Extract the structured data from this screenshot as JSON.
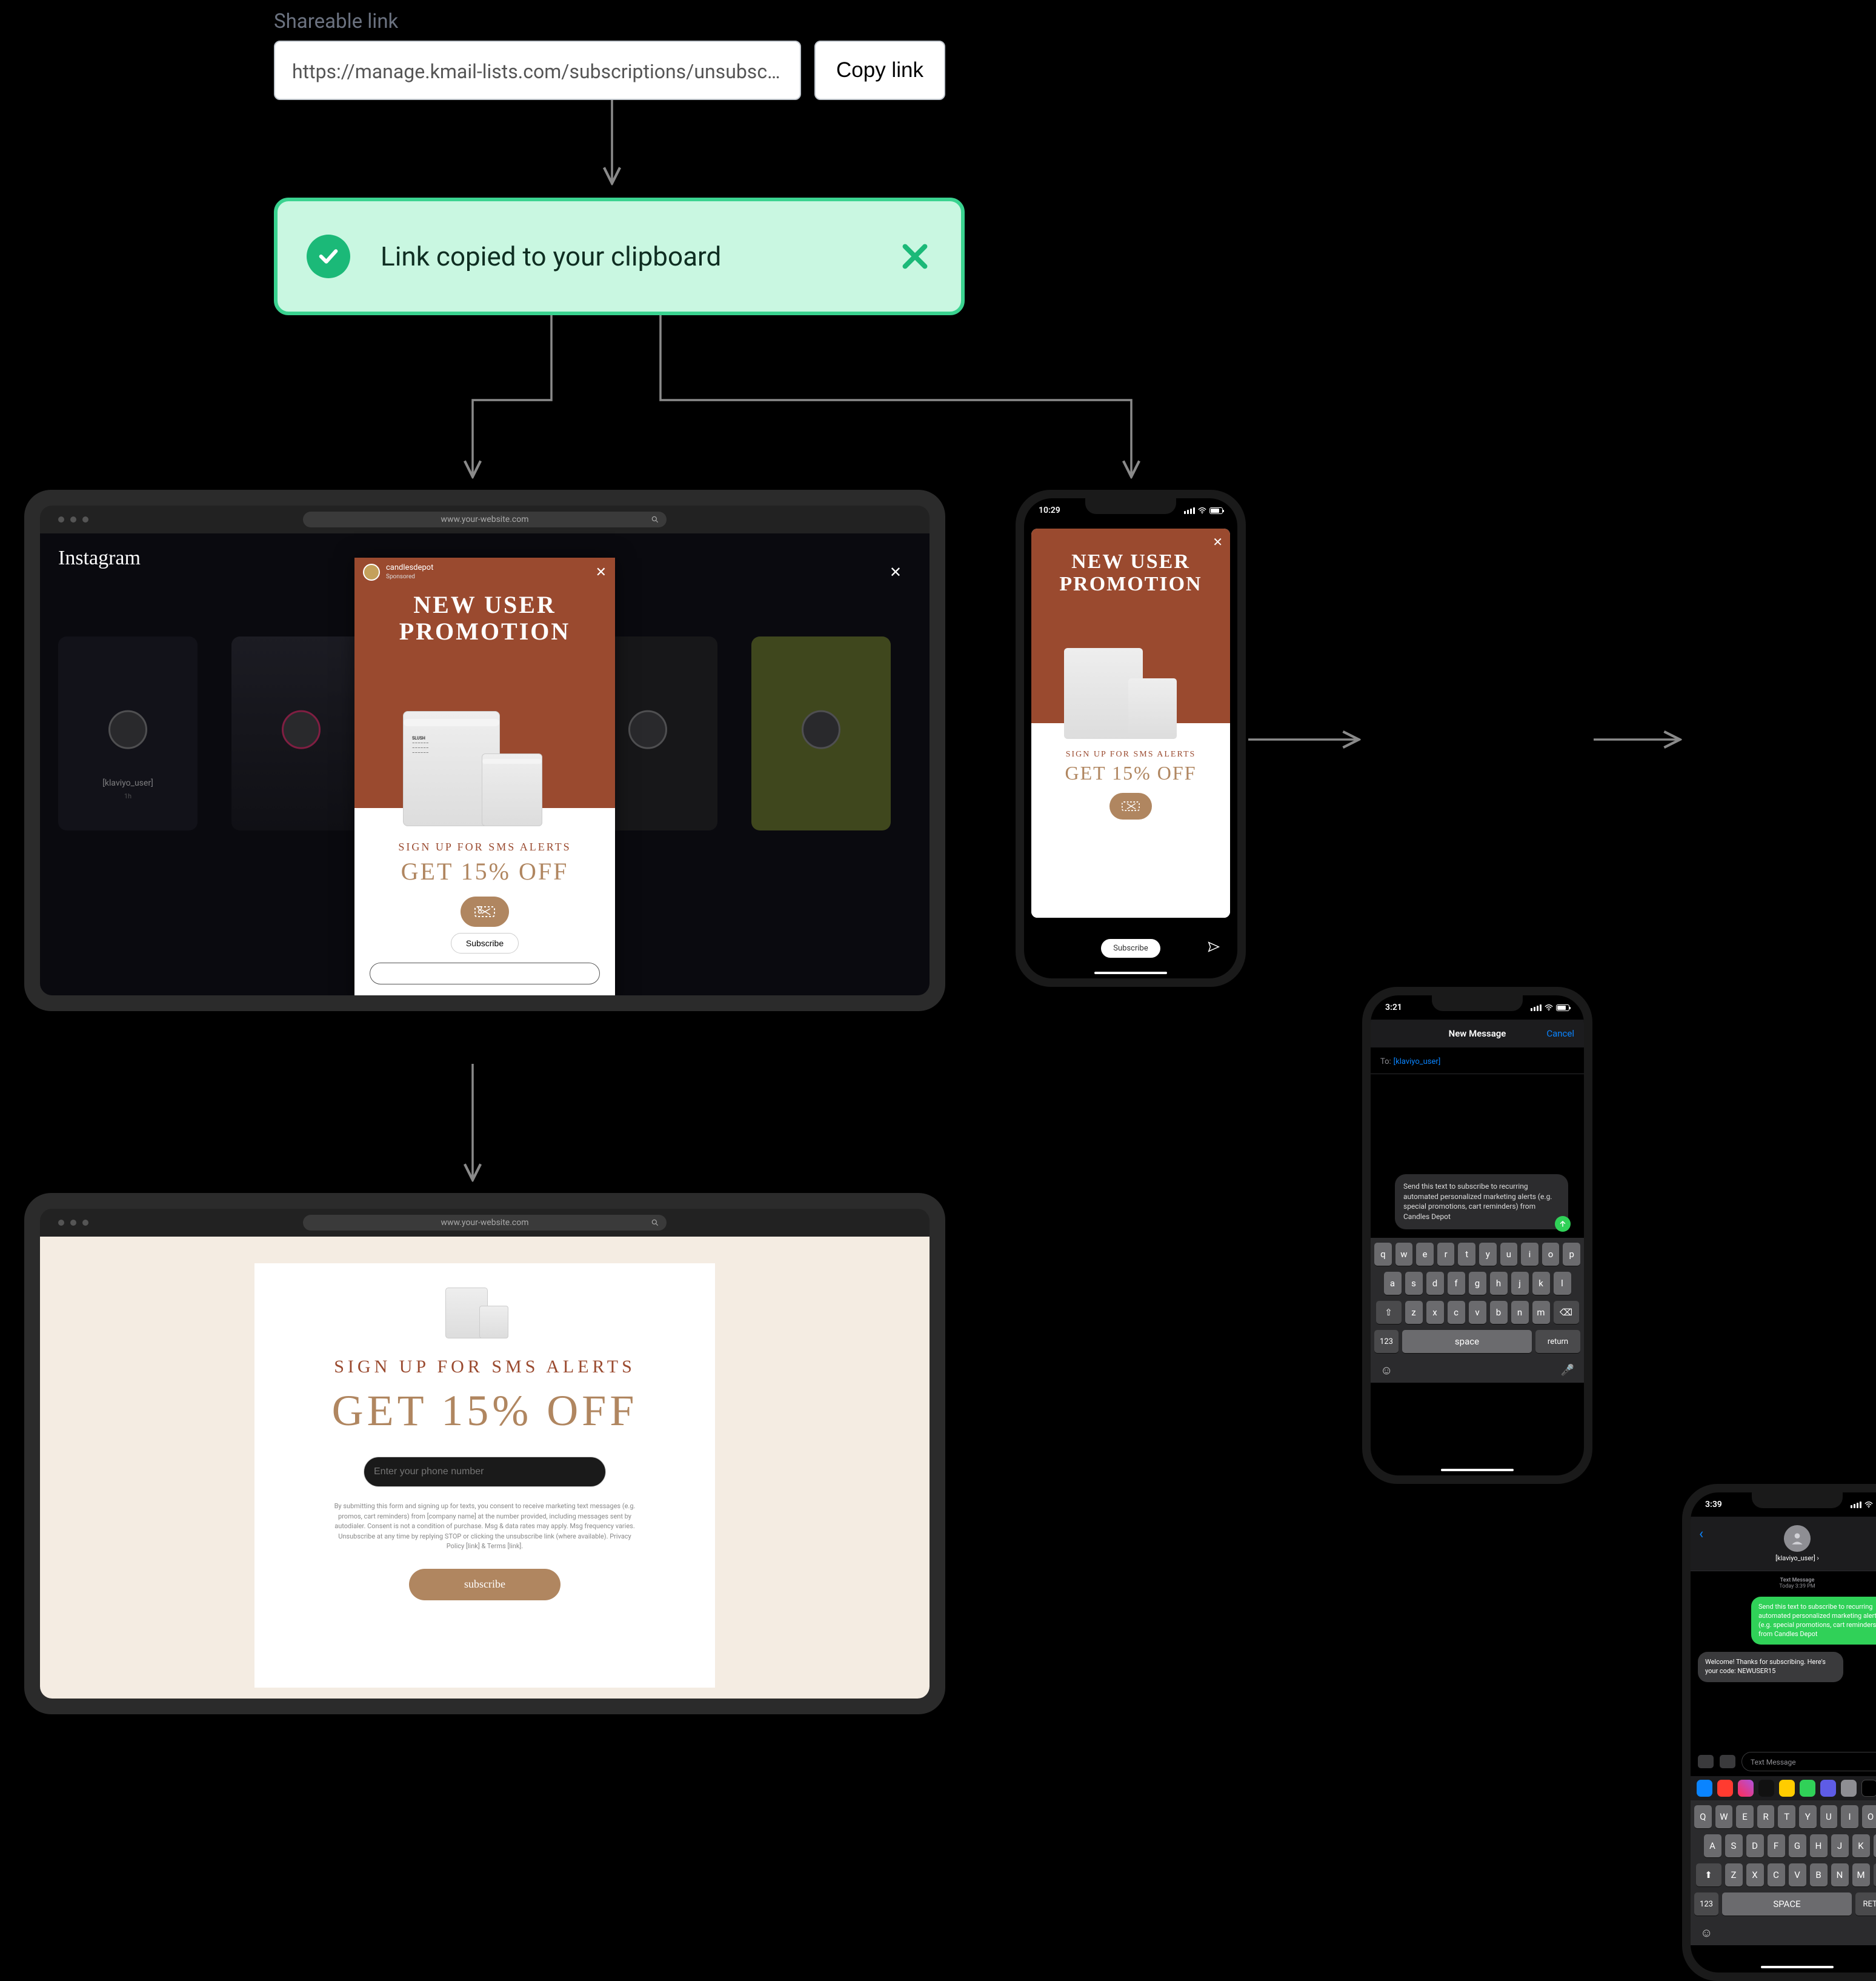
{
  "share": {
    "label": "Shareable link",
    "value": "https://manage.kmail-lists.com/subscriptions/unsubscribed?...",
    "button": "Copy link"
  },
  "toast": {
    "message": "Link copied to your clipboard"
  },
  "browser": {
    "url": "www.your-website.com"
  },
  "instagram": {
    "brand": "Instagram",
    "ad_brand": "candlesdepot",
    "ad_sponsored": "Sponsored",
    "story1_name": "[klaviyo_user]",
    "story1_sub": "1h"
  },
  "promo": {
    "headline_l1": "NEW USER",
    "headline_l2": "PROMOTION",
    "candle_label_title": "SLUSH",
    "sub1": "SIGN UP FOR SMS ALERTS",
    "sub2": "GET 15% OFF",
    "subscribe": "Subscribe"
  },
  "landing": {
    "t1": "SIGN UP FOR SMS ALERTS",
    "t2": "GET 15% OFF",
    "phone_placeholder": "Enter your phone number",
    "disclaimer": "By submitting this form and signing up for texts, you consent to receive marketing text messages (e.g. promos, cart reminders) from [company name] at the number provided, including messages sent by autodialer. Consent is not a condition of purchase. Msg & data rates may apply. Msg frequency varies. Unsubscribe at any time by replying STOP or clicking the unsubscribe link (where available). Privacy Policy [link] & Terms [link].",
    "subscribe": "subscribe"
  },
  "phone1": {
    "time": "10:29",
    "subscribe": "Subscribe"
  },
  "phone2": {
    "time": "3:21",
    "title": "New Message",
    "cancel": "Cancel",
    "to_label": "To:",
    "to_value": "[klaviyo_user]",
    "draft": "Send this text to subscribe to recurring automated personalized marketing alerts (e.g. special promotions, cart reminders) from Candles Depot"
  },
  "phone3": {
    "time": "3:39",
    "contact": "[klaviyo_user]",
    "ts_label": "Text Message",
    "ts_time": "Today 3:39 PM",
    "out": "Send this text to subscribe to recurring automated personalized marketing alerts (e.g. special promotions, cart reminders) from Candles Depot",
    "in": "Welcome! Thanks for subscribing. Here's your code: NEWUSER15",
    "input_placeholder": "Text Message"
  },
  "keyboard": {
    "space": "space",
    "return": "return",
    "num": "123"
  }
}
